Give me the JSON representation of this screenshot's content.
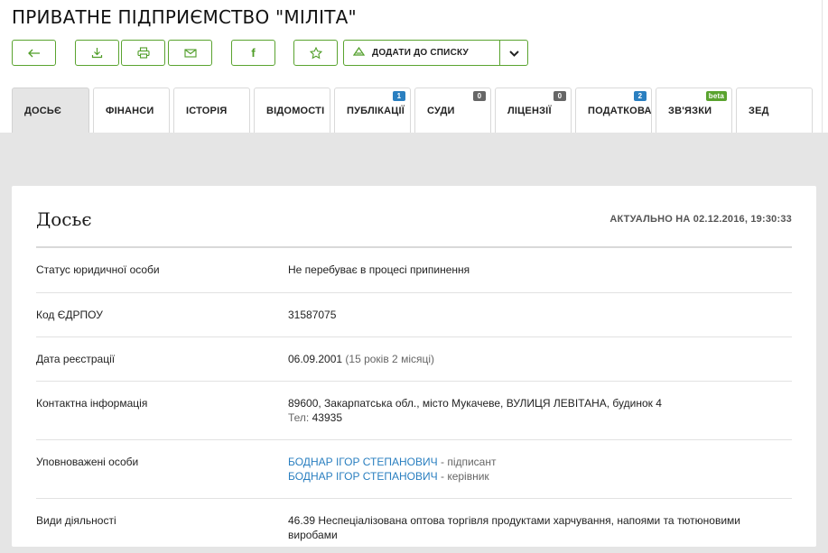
{
  "header": {
    "title": "ПРИВАТНЕ ПІДПРИЄМСТВО \"МІЛІТА\""
  },
  "toolbar": {
    "back_icon": "back-arrow-icon",
    "download_icon": "download-icon",
    "print_icon": "printer-icon",
    "email_icon": "envelope-icon",
    "facebook_label": "f",
    "favorite_icon": "star-icon",
    "add_to_list_label": "ДОДАТИ ДО СПИСКУ",
    "accent_color": "#5aa32f"
  },
  "tabs": [
    {
      "label": "ДОСЬЄ",
      "active": true
    },
    {
      "label": "ФІНАНСИ"
    },
    {
      "label": "ІСТОРІЯ"
    },
    {
      "label": "ВІДОМОСТІ"
    },
    {
      "label": "ПУБЛІКАЦІЇ",
      "badge": "1",
      "badge_color": "#2a7fc0"
    },
    {
      "label": "СУДИ",
      "badge": "0",
      "badge_color": "#666666"
    },
    {
      "label": "ЛІЦЕНЗІЇ",
      "badge": "0",
      "badge_color": "#666666"
    },
    {
      "label": "ПОДАТКОВА",
      "badge": "2",
      "badge_color": "#2a7fc0"
    },
    {
      "label": "ЗВ'ЯЗКИ",
      "badge": "beta",
      "badge_color": "#5aa32f"
    },
    {
      "label": "ЗЕД"
    }
  ],
  "dossier": {
    "title": "Досьє",
    "updated": "АКТУАЛЬНО НА 02.12.2016, 19:30:33",
    "status_label": "Статус юридичної особи",
    "status_value": "Не перебуває в процесі припинення",
    "code_label": "Код ЄДРПОУ",
    "code_value": "31587075",
    "reg_label": "Дата реєстрації",
    "reg_date": "06.09.2001",
    "reg_age": "(15 років 2 місяці)",
    "contact_label": "Контактна інформація",
    "contact_address": "89600, Закарпатська обл., місто Мукачеве, ВУЛИЦЯ ЛЕВІТАНА, будинок 4",
    "contact_phone_label": "Тел:",
    "contact_phone": "43935",
    "persons_label": "Уповноважені особи",
    "persons": [
      {
        "name": "БОДНАР ІГОР СТЕПАНОВИЧ",
        "role": "- підписант"
      },
      {
        "name": "БОДНАР ІГОР СТЕПАНОВИЧ",
        "role": "- керівник"
      }
    ],
    "activities_label": "Види діяльності",
    "activity": "46.39 Неспеціалізована оптова торгівля продуктами харчування, напоями та тютюновими виробами"
  }
}
